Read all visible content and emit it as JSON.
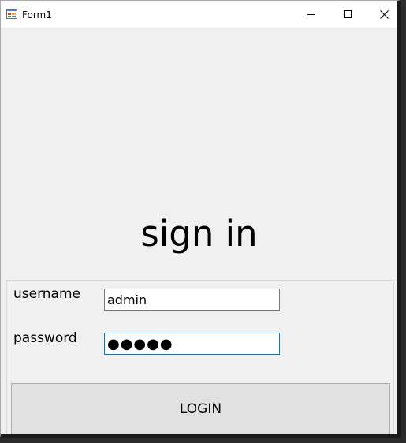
{
  "window": {
    "title": "Form1",
    "icon": "form-app-icon",
    "controls": {
      "minimize_icon": "minimize-icon",
      "maximize_icon": "maximize-icon",
      "close_icon": "close-icon"
    }
  },
  "form": {
    "heading": "sign in",
    "username_label": "username",
    "username_value": "admin",
    "password_label": "password",
    "password_value": "●●●●●",
    "login_label": "LOGIN"
  },
  "colors": {
    "background": "#f0f0f0",
    "titlebar": "#ffffff",
    "focus_border": "#0078d7",
    "button_face": "#e1e1e1"
  }
}
